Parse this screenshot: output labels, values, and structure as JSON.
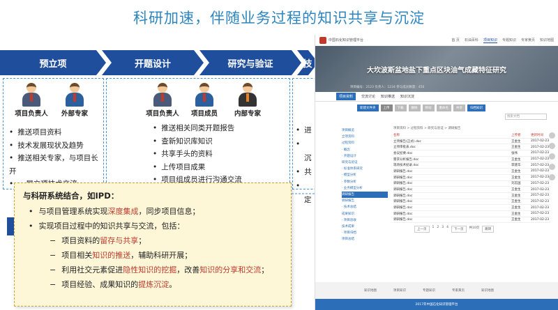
{
  "slide_title": "科研加速，伴随业务过程的知识共享与沉淀",
  "stages": [
    "预立项",
    "开题设计",
    "研究与验证",
    "技"
  ],
  "stage1": {
    "roles": [
      "项目负责人",
      "外部专家"
    ],
    "bullets": [
      "推送项目资料",
      "技术发展现状及趋势",
      "推送相关专家，与项目长开",
      "展立项技术交流"
    ]
  },
  "stage2": {
    "roles": [
      "项目负责人",
      "项目成员",
      "内部专家"
    ],
    "bullets": [
      "推送相关同类开题报告",
      "查新知识库知识",
      "共享手头的资料",
      "上传项目成果",
      "项目组成员进行沟通交流"
    ]
  },
  "stage3": {
    "bullets_partial": [
      "进",
      "沉",
      "共",
      "定"
    ]
  },
  "ipd": {
    "heading": "与科研系统结合，如IPD：",
    "line1_a": "与项目管理系统实现",
    "line1_b": "深度集成",
    "line1_c": "，同步项目信息；",
    "line2": "实现项目过程中的知识共享与交流，包括：",
    "s1_a": "项目资料的",
    "s1_b": "留存与共享",
    "s1_c": "；",
    "s2_a": "项目相关",
    "s2_b": "知识的推送",
    "s2_c": "，辅助科研开展；",
    "s3_a": "利用社交元素促进",
    "s3_b": "隐性知识的挖掘",
    "s3_c": "，改善",
    "s3_d": "知识的分享和交流",
    "s3_e": "；",
    "s4_a": "项目经验、成果知识的",
    "s4_b": "提炼沉淀",
    "s4_c": "。",
    "bullet_mark": "•",
    "dash_mark": "−"
  },
  "screen": {
    "brand": "中国石化知识管理平台",
    "nav": [
      "首 页",
      "石油百科",
      "项目知识",
      "专题知识",
      "专家黄页",
      "知识地图"
    ],
    "banner_title": "大坎波斯盆地盐下重点区块油气成藏特征研究",
    "meta": "项目编号：2123    负责人：1234    参与成员数量：456",
    "tabs": [
      "项目资料",
      "交流讨论",
      "知识推送",
      "知识沉淀"
    ],
    "toolbar": [
      "新建文件夹",
      "上传",
      "下载",
      "删除",
      "移动",
      "重命名",
      "共享",
      "归档知识"
    ],
    "search_placeholder": "搜索文档",
    "tree": [
      "项目概览",
      "立项资料",
      "过程资料",
      "· 概念",
      "· 开题设计",
      "研究与验证",
      "· 标准体系研究",
      "· 模型分析",
      "· 参数分析",
      "· 业务模型分析",
      "调研报告",
      "调研报告",
      "· 技术总结",
      "成果知识",
      "· 项目验收",
      "技术成果",
      "· 项目归档",
      "项目总结"
    ],
    "breadcrumb": "项目资料 > 过程资料 > 研究与验证 > 调研报告",
    "list_header": {
      "name": "名称",
      "owner": "上传者",
      "date": "更新时间"
    },
    "rows": [
      {
        "name": "立项报告(正式).doc",
        "owner": "王金生",
        "date": "2017-02-23"
      },
      {
        "name": "立项审批表.doc",
        "owner": "王金生",
        "date": "2017-02-23"
      },
      {
        "name": "会议纪要.doc",
        "owner": "张伟",
        "date": "2017-02-23"
      },
      {
        "name": "需求分析报告.doc",
        "owner": "王金生",
        "date": "2017-02-23"
      },
      {
        "name": "现场技术纪录.doc",
        "owner": "李建华",
        "date": "2017-02-23"
      },
      {
        "name": "调研报告.doc",
        "owner": "王金生",
        "date": "2017-02-23"
      },
      {
        "name": "调研报告.doc",
        "owner": "王金生",
        "date": "2017-02-23"
      },
      {
        "name": "调研报告.doc",
        "owner": "刘志国",
        "date": "2017-02-23"
      },
      {
        "name": "调研报告.doc",
        "owner": "王金生",
        "date": "2017-02-23"
      },
      {
        "name": "调研报告.doc",
        "owner": "王金生",
        "date": "2017-02-23"
      },
      {
        "name": "调研报告.doc",
        "owner": "王金生",
        "date": "2017-02-23"
      },
      {
        "name": "调研报告.doc",
        "owner": "王金生",
        "date": "2017-02-23"
      },
      {
        "name": "调研报告.doc",
        "owner": "王金生",
        "date": "2017-02-23"
      },
      {
        "name": "调研报告.doc",
        "owner": "王金生",
        "date": "2017-02-23"
      }
    ],
    "pager": [
      "上一页",
      "1",
      "2",
      "3",
      "4",
      "下一页",
      "共10页",
      "跳转"
    ],
    "footer_links": [
      "知识地图",
      "项目知识",
      "专题知识",
      "专家黄页",
      "知识地图"
    ],
    "copyright": "2017年中国石化知识管理平台"
  }
}
